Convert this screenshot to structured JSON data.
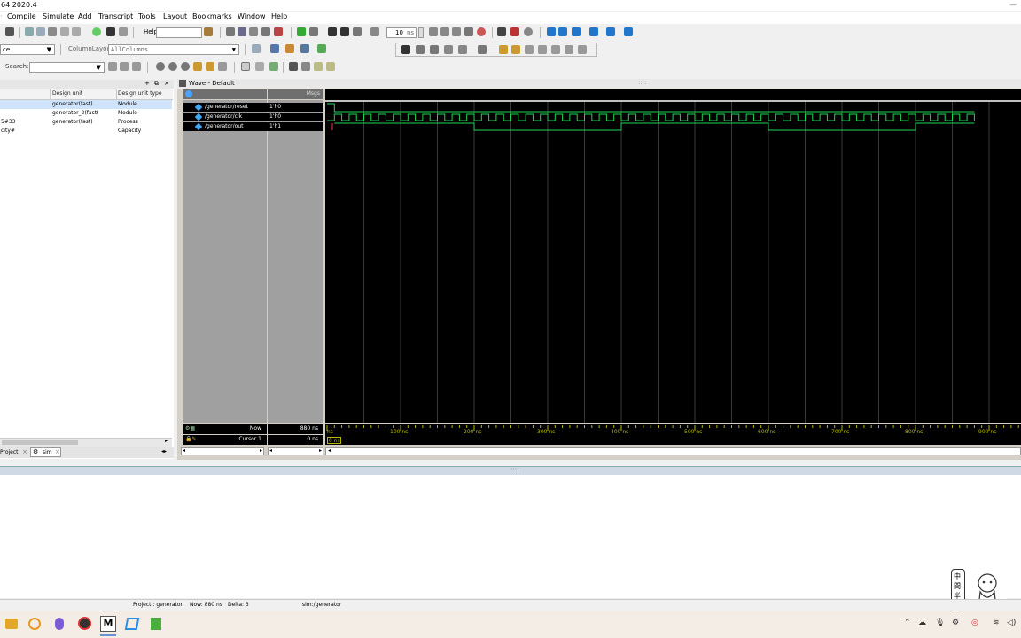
{
  "window": {
    "title": "64 2020.4"
  },
  "menu": [
    "Compile",
    "Simulate",
    "Add",
    "Transcript",
    "Tools",
    "Layout",
    "Bookmarks",
    "Window",
    "Help"
  ],
  "toolbar": {
    "help_label": "Help",
    "run_length_value": "10",
    "run_length_unit": "ns",
    "context_value": "ce",
    "column_layout_label": "ColumnLayout",
    "column_layout_value": "AllColumns",
    "search_label": "Search:"
  },
  "library_panel": {
    "columns": [
      "Design unit",
      "Design unit type"
    ],
    "rows": [
      {
        "name": "",
        "design_unit": "generator(fast)",
        "type": "Module"
      },
      {
        "name": "",
        "design_unit": "generator_2(fast)",
        "type": "Module"
      },
      {
        "name": "5#33",
        "design_unit": "generator(fast)",
        "type": "Process"
      },
      {
        "name": "city#",
        "design_unit": "",
        "type": "Capacity"
      }
    ],
    "tabs": [
      "Project",
      "sim"
    ]
  },
  "wave": {
    "title": "Wave - Default",
    "msgs_label": "Msgs",
    "signals": [
      {
        "name": "/generator/reset",
        "value": "1'h0"
      },
      {
        "name": "/generator/clk",
        "value": "1'h0"
      },
      {
        "name": "/generator/out",
        "value": "1'h1"
      }
    ],
    "now_label": "Now",
    "now_value": "880 ns",
    "cursor_label": "Cursor 1",
    "cursor_value": "0 ns",
    "cursor_tag": "0 ns",
    "axis_start_label": "ns",
    "timeline_ticks": [
      "100 ns",
      "200 ns",
      "300 ns",
      "400 ns",
      "500 ns",
      "600 ns",
      "700 ns",
      "800 ns",
      "900 ns"
    ]
  },
  "status_bar": {
    "project": "Project : generator",
    "now": "Now: 880 ns",
    "delta": "Delta: 3",
    "context": "sim:/generator"
  },
  "widget": {
    "chars": [
      "中",
      "間",
      "半"
    ]
  },
  "colors": {
    "wave_bg": "#000000",
    "wave_signal": "#1fd655",
    "grid": "#333333",
    "timeline": "#b8b800"
  }
}
